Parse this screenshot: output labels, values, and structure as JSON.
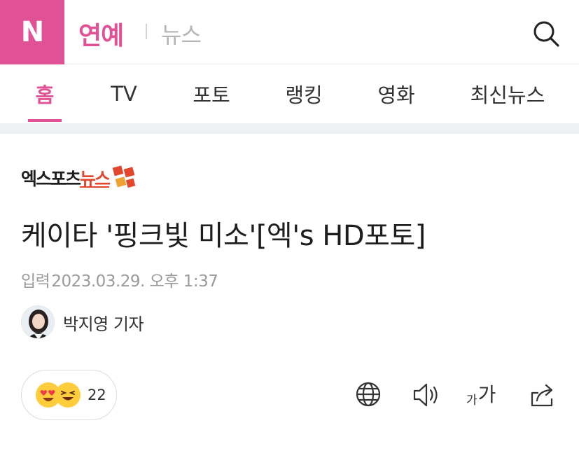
{
  "header": {
    "logo": "N",
    "section_title": "연예",
    "sub_title": "뉴스"
  },
  "tabs": [
    {
      "label": "홈",
      "active": true
    },
    {
      "label": "TV",
      "active": false
    },
    {
      "label": "포토",
      "active": false
    },
    {
      "label": "랭킹",
      "active": false
    },
    {
      "label": "영화",
      "active": false
    },
    {
      "label": "최신뉴스",
      "active": false
    }
  ],
  "article": {
    "press": {
      "part_a": "엑스포츠",
      "part_b": "뉴스"
    },
    "headline": "케이타 '핑크빛 미소'[엑's HD포토]",
    "date_label": "입력",
    "date_value": "2023.03.29. 오후 1:37",
    "reporter": "박지영 기자"
  },
  "reaction": {
    "count": "22",
    "emojis": [
      "heart-eyes-emoji",
      "laughing-emoji"
    ]
  },
  "tools": {
    "font_small": "가",
    "font_big": "가"
  },
  "colors": {
    "brand": "#e05295",
    "press_accent": "#e2462d",
    "band": "#eef0f3"
  }
}
